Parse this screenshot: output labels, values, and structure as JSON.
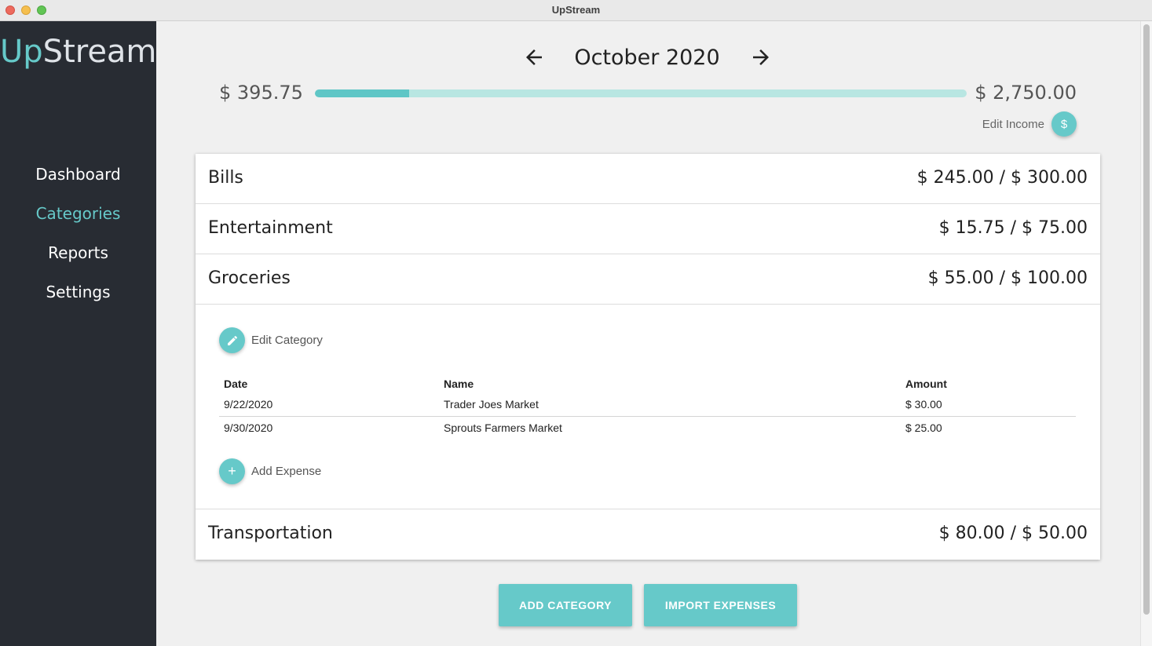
{
  "window": {
    "title": "UpStream"
  },
  "sidebar": {
    "logo_prefix": "Up",
    "logo_suffix": "Stream",
    "items": [
      {
        "label": "Dashboard",
        "active": false
      },
      {
        "label": "Categories",
        "active": true
      },
      {
        "label": "Reports",
        "active": false
      },
      {
        "label": "Settings",
        "active": false
      }
    ]
  },
  "header": {
    "month": "October 2020",
    "prev_icon": "arrow-left-icon",
    "next_icon": "arrow-right-icon",
    "spent": "$ 395.75",
    "income": "$ 2,750.00",
    "progress_fraction": 0.144,
    "edit_income_label": "Edit Income",
    "edit_income_icon": "$"
  },
  "categories": [
    {
      "name": "Bills",
      "amount": "$ 245.00 / $ 300.00"
    },
    {
      "name": "Entertainment",
      "amount": "$ 15.75 / $ 75.00"
    },
    {
      "name": "Groceries",
      "amount": "$ 55.00 / $ 100.00"
    },
    {
      "name": "Transportation",
      "amount": "$ 80.00 / $ 50.00"
    }
  ],
  "detail": {
    "edit_category_label": "Edit Category",
    "add_expense_label": "Add Expense",
    "add_expense_icon": "+",
    "columns": [
      "Date",
      "Name",
      "Amount"
    ],
    "rows": [
      {
        "date": "9/22/2020",
        "name": "Trader Joes Market",
        "amount": "$ 30.00"
      },
      {
        "date": "9/30/2020",
        "name": "Sprouts Farmers Market",
        "amount": "$ 25.00"
      }
    ]
  },
  "actions": {
    "add_category": "ADD CATEGORY",
    "import_expenses": "IMPORT EXPENSES"
  },
  "colors": {
    "accent": "#66c9c9",
    "sidebar_bg": "#282c33",
    "progress_track": "#b8e6e2"
  }
}
